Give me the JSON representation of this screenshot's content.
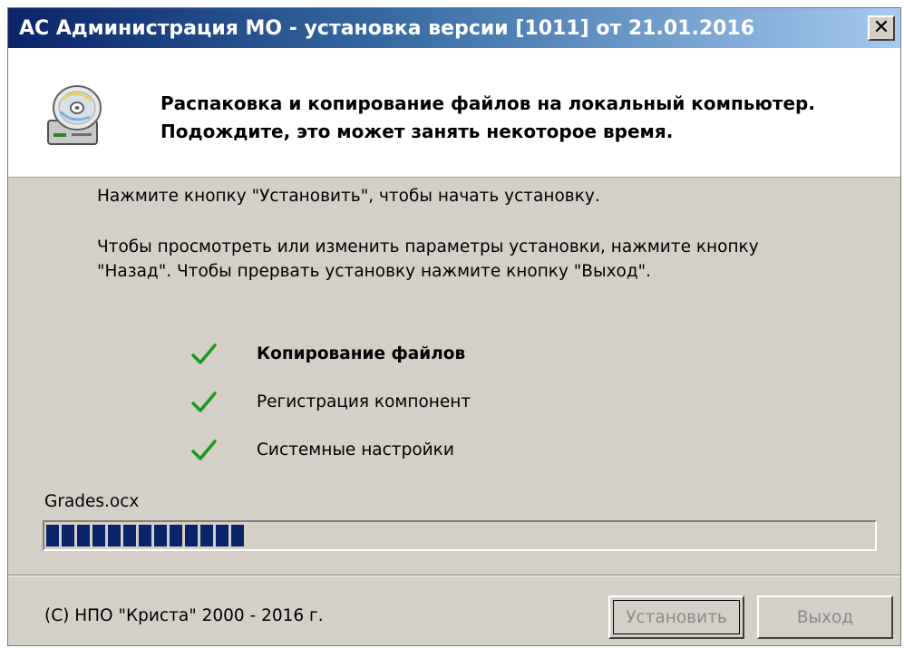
{
  "window": {
    "title": "АС Администрация МО - установка версии [1011] от 21.01.2016",
    "close_symbol": "✕"
  },
  "header": {
    "line1": "Распаковка и копирование файлов на локальный компьютер.",
    "line2": "Подождите, это может занять некоторое время.",
    "icon": "cd-drive-icon"
  },
  "body": {
    "instruction1": "Нажмите кнопку \"Установить\", чтобы начать установку.",
    "instruction2_line1": "Чтобы просмотреть или изменить параметры установки, нажмите кнопку",
    "instruction2_line2": "\"Назад\". Чтобы прервать установку нажмите кнопку \"Выход\"."
  },
  "steps": [
    {
      "label": "Копирование файлов",
      "done": true,
      "current": true
    },
    {
      "label": "Регистрация компонент",
      "done": true,
      "current": false
    },
    {
      "label": "Системные настройки",
      "done": true,
      "current": false
    }
  ],
  "progress": {
    "current_file": "Grades.ocx",
    "fraction": 0.24,
    "color": "#0a246a"
  },
  "footer": {
    "copyright": "(С) НПО \"Криста\" 2000 - 2016 г.",
    "install_label": "Установить",
    "exit_label": "Выход"
  },
  "colors": {
    "check": "#1a9a1a",
    "face": "#d4d0c8"
  }
}
